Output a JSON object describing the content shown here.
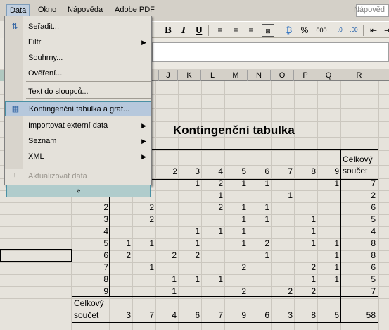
{
  "menubar": {
    "items": [
      "Data",
      "Okno",
      "Nápověda",
      "Adobe PDF"
    ],
    "help_hint": "Nápověd"
  },
  "toolbar": {
    "bold": "B",
    "italic": "I",
    "underline": "U",
    "percent": "%",
    "thousands": "000"
  },
  "menu": {
    "items": [
      {
        "label": "Seřadit...",
        "icon": "sort-az-icon",
        "arrow": ""
      },
      {
        "label": "Filtr",
        "icon": "",
        "arrow": "▶"
      },
      {
        "label": "Souhrny...",
        "icon": "",
        "arrow": ""
      },
      {
        "label": "Ověření...",
        "icon": "",
        "arrow": ""
      },
      {
        "label": "Text do sloupců...",
        "icon": "",
        "arrow": ""
      },
      {
        "label": "Kontingenční tabulka a graf...",
        "icon": "pivot-table-icon",
        "arrow": ""
      },
      {
        "label": "Importovat externí data",
        "icon": "",
        "arrow": "▶"
      },
      {
        "label": "Seznam",
        "icon": "",
        "arrow": "▶"
      },
      {
        "label": "XML",
        "icon": "",
        "arrow": "▶"
      },
      {
        "label": "Aktualizovat data",
        "icon": "refresh-icon",
        "arrow": ""
      }
    ],
    "expand": "»"
  },
  "columns": [
    "J",
    "K",
    "L",
    "M",
    "N",
    "O",
    "P",
    "Q",
    "R"
  ],
  "pivot": {
    "title": "Kontingenční tabulka",
    "col_headers": [
      "2",
      "3",
      "4",
      "5",
      "6",
      "7",
      "8",
      "9"
    ],
    "total_header": [
      "Celkový",
      "součet"
    ],
    "rows": [
      {
        "label": "",
        "cells": [
          "",
          "",
          "",
          "1",
          "2",
          "1",
          "1",
          "",
          "",
          "1"
        ],
        "total": "7"
      },
      {
        "label": "",
        "cells": [
          "",
          "",
          "",
          "",
          "1",
          "",
          "",
          "1",
          "",
          ""
        ],
        "total": "2"
      },
      {
        "label": "2",
        "cells": [
          "",
          "2",
          "",
          "",
          "2",
          "1",
          "1",
          "",
          "",
          ""
        ],
        "total": "6"
      },
      {
        "label": "3",
        "cells": [
          "",
          "2",
          "",
          "",
          "",
          "1",
          "1",
          "",
          "1",
          ""
        ],
        "total": "5"
      },
      {
        "label": "4",
        "cells": [
          "",
          "",
          "",
          "1",
          "1",
          "1",
          "",
          "",
          "1",
          ""
        ],
        "total": "4"
      },
      {
        "label": "5",
        "cells": [
          "1",
          "1",
          "",
          "1",
          "",
          "1",
          "2",
          "",
          "1",
          "1"
        ],
        "total": "8"
      },
      {
        "label": "6",
        "cells": [
          "2",
          "",
          "2",
          "2",
          "",
          "",
          "1",
          "",
          "",
          "1"
        ],
        "total": "8"
      },
      {
        "label": "7",
        "cells": [
          "",
          "1",
          "",
          "",
          "",
          "2",
          "",
          "",
          "2",
          "1"
        ],
        "total": "6"
      },
      {
        "label": "8",
        "cells": [
          "",
          "",
          "1",
          "1",
          "1",
          "",
          "",
          "",
          "1",
          "1"
        ],
        "total": "5"
      },
      {
        "label": "9",
        "cells": [
          "",
          "",
          "1",
          "",
          "",
          "2",
          "",
          "2",
          "2",
          ""
        ],
        "total": "7"
      }
    ],
    "grand_label": [
      "Celkový",
      "součet"
    ],
    "grand_cells": [
      "3",
      "7",
      "4",
      "6",
      "7",
      "9",
      "6",
      "3",
      "8",
      "5"
    ],
    "grand_total": "58"
  }
}
